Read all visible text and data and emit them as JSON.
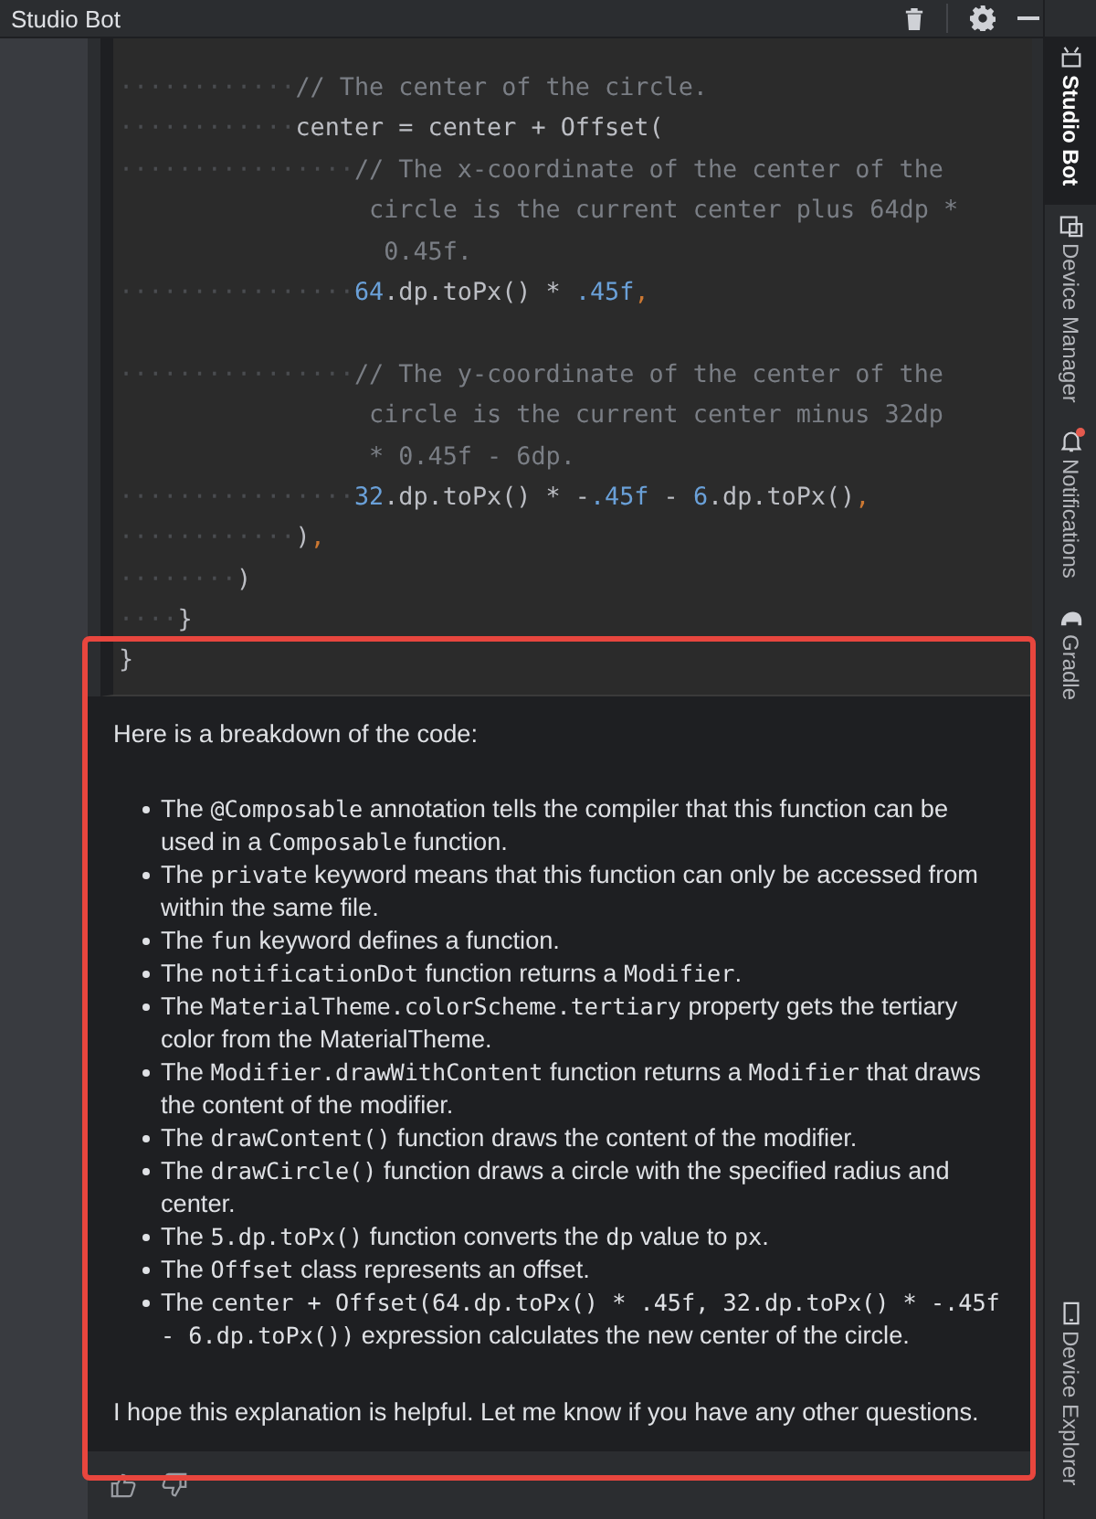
{
  "window": {
    "title": "Studio Bot"
  },
  "code_lines": [
    [
      {
        "kind": "guide",
        "text": "············"
      },
      {
        "kind": "comment",
        "text": "// The center of the circle."
      }
    ],
    [
      {
        "kind": "guide",
        "text": "············"
      },
      {
        "kind": "plain",
        "text": "center = center + Offset("
      }
    ],
    [
      {
        "kind": "guide",
        "text": "················"
      },
      {
        "kind": "comment",
        "text": "// The x-coordinate of the center of the"
      }
    ],
    [
      {
        "kind": "comment",
        "text": "                 circle is the current center plus 64dp *"
      }
    ],
    [
      {
        "kind": "comment",
        "text": "                  0.45f."
      }
    ],
    [
      {
        "kind": "guide",
        "text": "················"
      },
      {
        "kind": "number",
        "text": "64"
      },
      {
        "kind": "plain",
        "text": ".dp.toPx() * "
      },
      {
        "kind": "number",
        "text": ".45f"
      },
      {
        "kind": "punct",
        "text": ","
      }
    ],
    [
      {
        "kind": "guide",
        "text": "················",
        "gap_before": true
      },
      {
        "kind": "comment",
        "text": "// The y-coordinate of the center of the"
      }
    ],
    [
      {
        "kind": "comment",
        "text": "                 circle is the current center minus 32dp"
      }
    ],
    [
      {
        "kind": "comment",
        "text": "                 * 0.45f - 6dp."
      }
    ],
    [
      {
        "kind": "guide",
        "text": "················"
      },
      {
        "kind": "number",
        "text": "32"
      },
      {
        "kind": "plain",
        "text": ".dp.toPx() * -"
      },
      {
        "kind": "number",
        "text": ".45f"
      },
      {
        "kind": "plain",
        "text": " - "
      },
      {
        "kind": "number",
        "text": "6"
      },
      {
        "kind": "plain",
        "text": ".dp.toPx()"
      },
      {
        "kind": "punct",
        "text": ","
      }
    ],
    [
      {
        "kind": "guide",
        "text": "············"
      },
      {
        "kind": "plain",
        "text": ")"
      },
      {
        "kind": "punct",
        "text": ","
      }
    ],
    [
      {
        "kind": "guide",
        "text": "········"
      },
      {
        "kind": "plain",
        "text": ")"
      }
    ],
    [
      {
        "kind": "guide",
        "text": "····"
      },
      {
        "kind": "plain",
        "text": "}"
      }
    ],
    [
      {
        "kind": "plain",
        "text": "}"
      }
    ]
  ],
  "answer": {
    "intro": "Here is a breakdown of the code:",
    "bullets": [
      [
        {
          "text": "The "
        },
        {
          "text": "@Composable",
          "code": true
        },
        {
          "text": " annotation tells the compiler that this function can be used in a "
        },
        {
          "text": "Composable",
          "code": true
        },
        {
          "text": " function."
        }
      ],
      [
        {
          "text": "The "
        },
        {
          "text": "private",
          "code": true
        },
        {
          "text": " keyword means that this function can only be accessed from within the same file."
        }
      ],
      [
        {
          "text": "The "
        },
        {
          "text": "fun",
          "code": true
        },
        {
          "text": " keyword defines a function."
        }
      ],
      [
        {
          "text": "The "
        },
        {
          "text": "notificationDot",
          "code": true
        },
        {
          "text": " function returns a "
        },
        {
          "text": "Modifier",
          "code": true
        },
        {
          "text": "."
        }
      ],
      [
        {
          "text": "The "
        },
        {
          "text": "MaterialTheme.colorScheme.tertiary",
          "code": true
        },
        {
          "text": " property gets the tertiary color from the MaterialTheme."
        }
      ],
      [
        {
          "text": "The "
        },
        {
          "text": "Modifier.drawWithContent",
          "code": true
        },
        {
          "text": " function returns a "
        },
        {
          "text": "Modifier",
          "code": true
        },
        {
          "text": " that draws the content of the modifier."
        }
      ],
      [
        {
          "text": "The "
        },
        {
          "text": "drawContent()",
          "code": true
        },
        {
          "text": " function draws the content of the modifier."
        }
      ],
      [
        {
          "text": "The "
        },
        {
          "text": "drawCircle()",
          "code": true
        },
        {
          "text": " function draws a circle with the specified radius and center."
        }
      ],
      [
        {
          "text": "The "
        },
        {
          "text": "5.dp.toPx()",
          "code": true
        },
        {
          "text": " function converts the "
        },
        {
          "text": "dp",
          "code": true
        },
        {
          "text": " value to "
        },
        {
          "text": "px",
          "code": true
        },
        {
          "text": "."
        }
      ],
      [
        {
          "text": "The "
        },
        {
          "text": "Offset",
          "code": true
        },
        {
          "text": " class represents an offset."
        }
      ],
      [
        {
          "text": "The "
        },
        {
          "text": "center + Offset(64.dp.toPx() * .45f, 32.dp.toPx() * -.45f - 6.dp.toPx())",
          "code": true
        },
        {
          "text": " expression calculates the new center of the circle."
        }
      ]
    ],
    "closing": "I hope this explanation is helpful. Let me know if you have any other questions."
  },
  "side_tabs": [
    {
      "label": "Studio Bot",
      "selected": true,
      "kind": "bot"
    },
    {
      "label": "Device Manager",
      "selected": false,
      "kind": "device"
    },
    {
      "label": "Notifications",
      "selected": false,
      "kind": "bell",
      "badge": true
    },
    {
      "label": "Gradle",
      "selected": false,
      "kind": "gradle"
    }
  ],
  "side_tabs_bottom": [
    {
      "label": "Device Explorer",
      "selected": false,
      "kind": "phone"
    }
  ]
}
